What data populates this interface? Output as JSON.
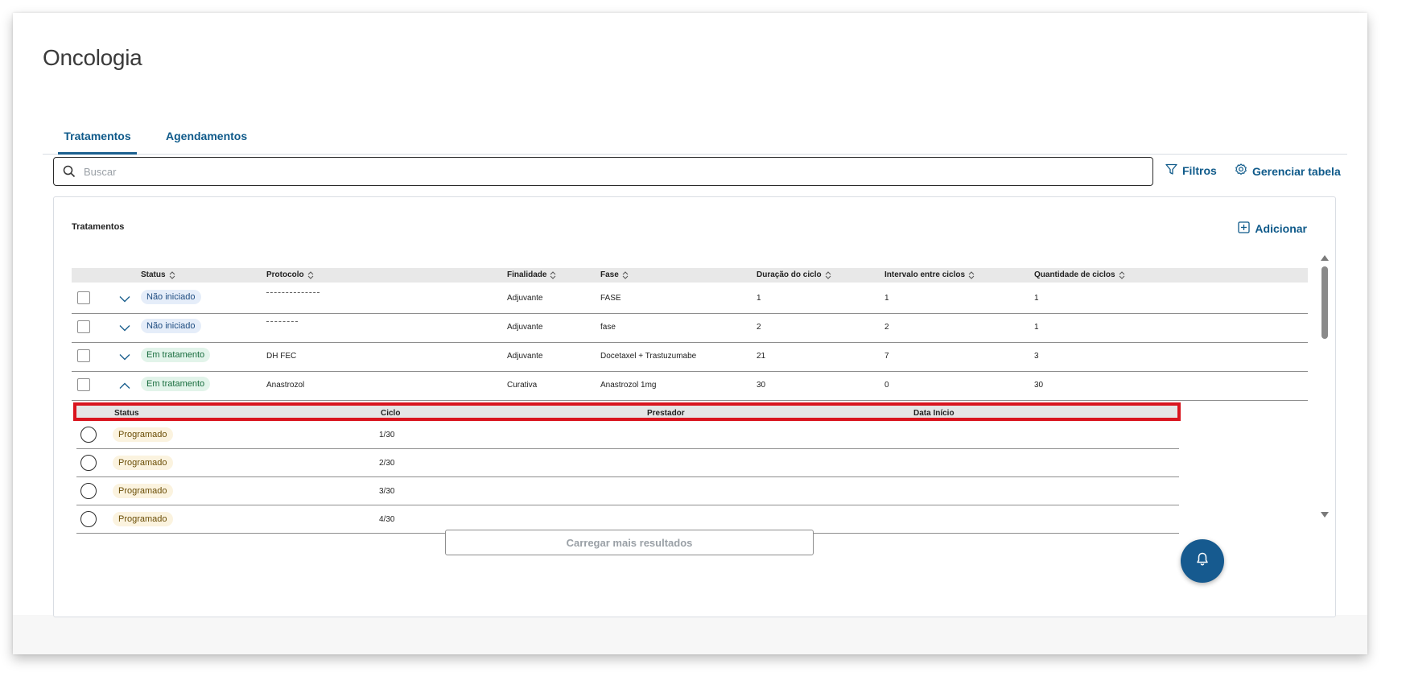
{
  "page": {
    "title": "Oncologia"
  },
  "tabs": [
    {
      "label": "Tratamentos",
      "active": true
    },
    {
      "label": "Agendamentos",
      "active": false
    }
  ],
  "search": {
    "placeholder": "Buscar",
    "value": ""
  },
  "toolbar": {
    "filters_label": "Filtros",
    "manage_table_label": "Gerenciar tabela"
  },
  "card": {
    "title": "Tratamentos",
    "add_label": "Adicionar"
  },
  "table": {
    "columns": [
      "Status",
      "Protocolo",
      "Finalidade",
      "Fase",
      "Duração do ciclo",
      "Intervalo entre ciclos",
      "Quantidade de ciclos"
    ],
    "rows": [
      {
        "status": "Não iniciado",
        "status_tone": "blue",
        "protocolo": "",
        "protocolo_redacted": true,
        "finalidade": "Adjuvante",
        "fase": "FASE",
        "duracao": "1",
        "intervalo": "1",
        "quantidade": "1",
        "expanded": false
      },
      {
        "status": "Não iniciado",
        "status_tone": "blue",
        "protocolo": "",
        "protocolo_redacted": true,
        "finalidade": "Adjuvante",
        "fase": "fase",
        "duracao": "2",
        "intervalo": "2",
        "quantidade": "1",
        "expanded": false
      },
      {
        "status": "Em tratamento",
        "status_tone": "green",
        "protocolo": "DH FEC",
        "finalidade": "Adjuvante",
        "fase": "Docetaxel + Trastuzumabe",
        "duracao": "21",
        "intervalo": "7",
        "quantidade": "3",
        "expanded": false
      },
      {
        "status": "Em tratamento",
        "status_tone": "green",
        "protocolo": "Anastrozol",
        "finalidade": "Curativa",
        "fase": "Anastrozol 1mg",
        "duracao": "30",
        "intervalo": "0",
        "quantidade": "30",
        "expanded": true
      }
    ]
  },
  "subtable": {
    "columns": [
      "Status",
      "Ciclo",
      "Prestador",
      "Data Início"
    ],
    "rows": [
      {
        "status": "Programado",
        "ciclo": "1/30"
      },
      {
        "status": "Programado",
        "ciclo": "2/30"
      },
      {
        "status": "Programado",
        "ciclo": "3/30"
      },
      {
        "status": "Programado",
        "ciclo": "4/30"
      }
    ]
  },
  "load_more_label": "Carregar mais resultados",
  "colors": {
    "primary": "#165a8f",
    "highlight": "#d9141e"
  }
}
